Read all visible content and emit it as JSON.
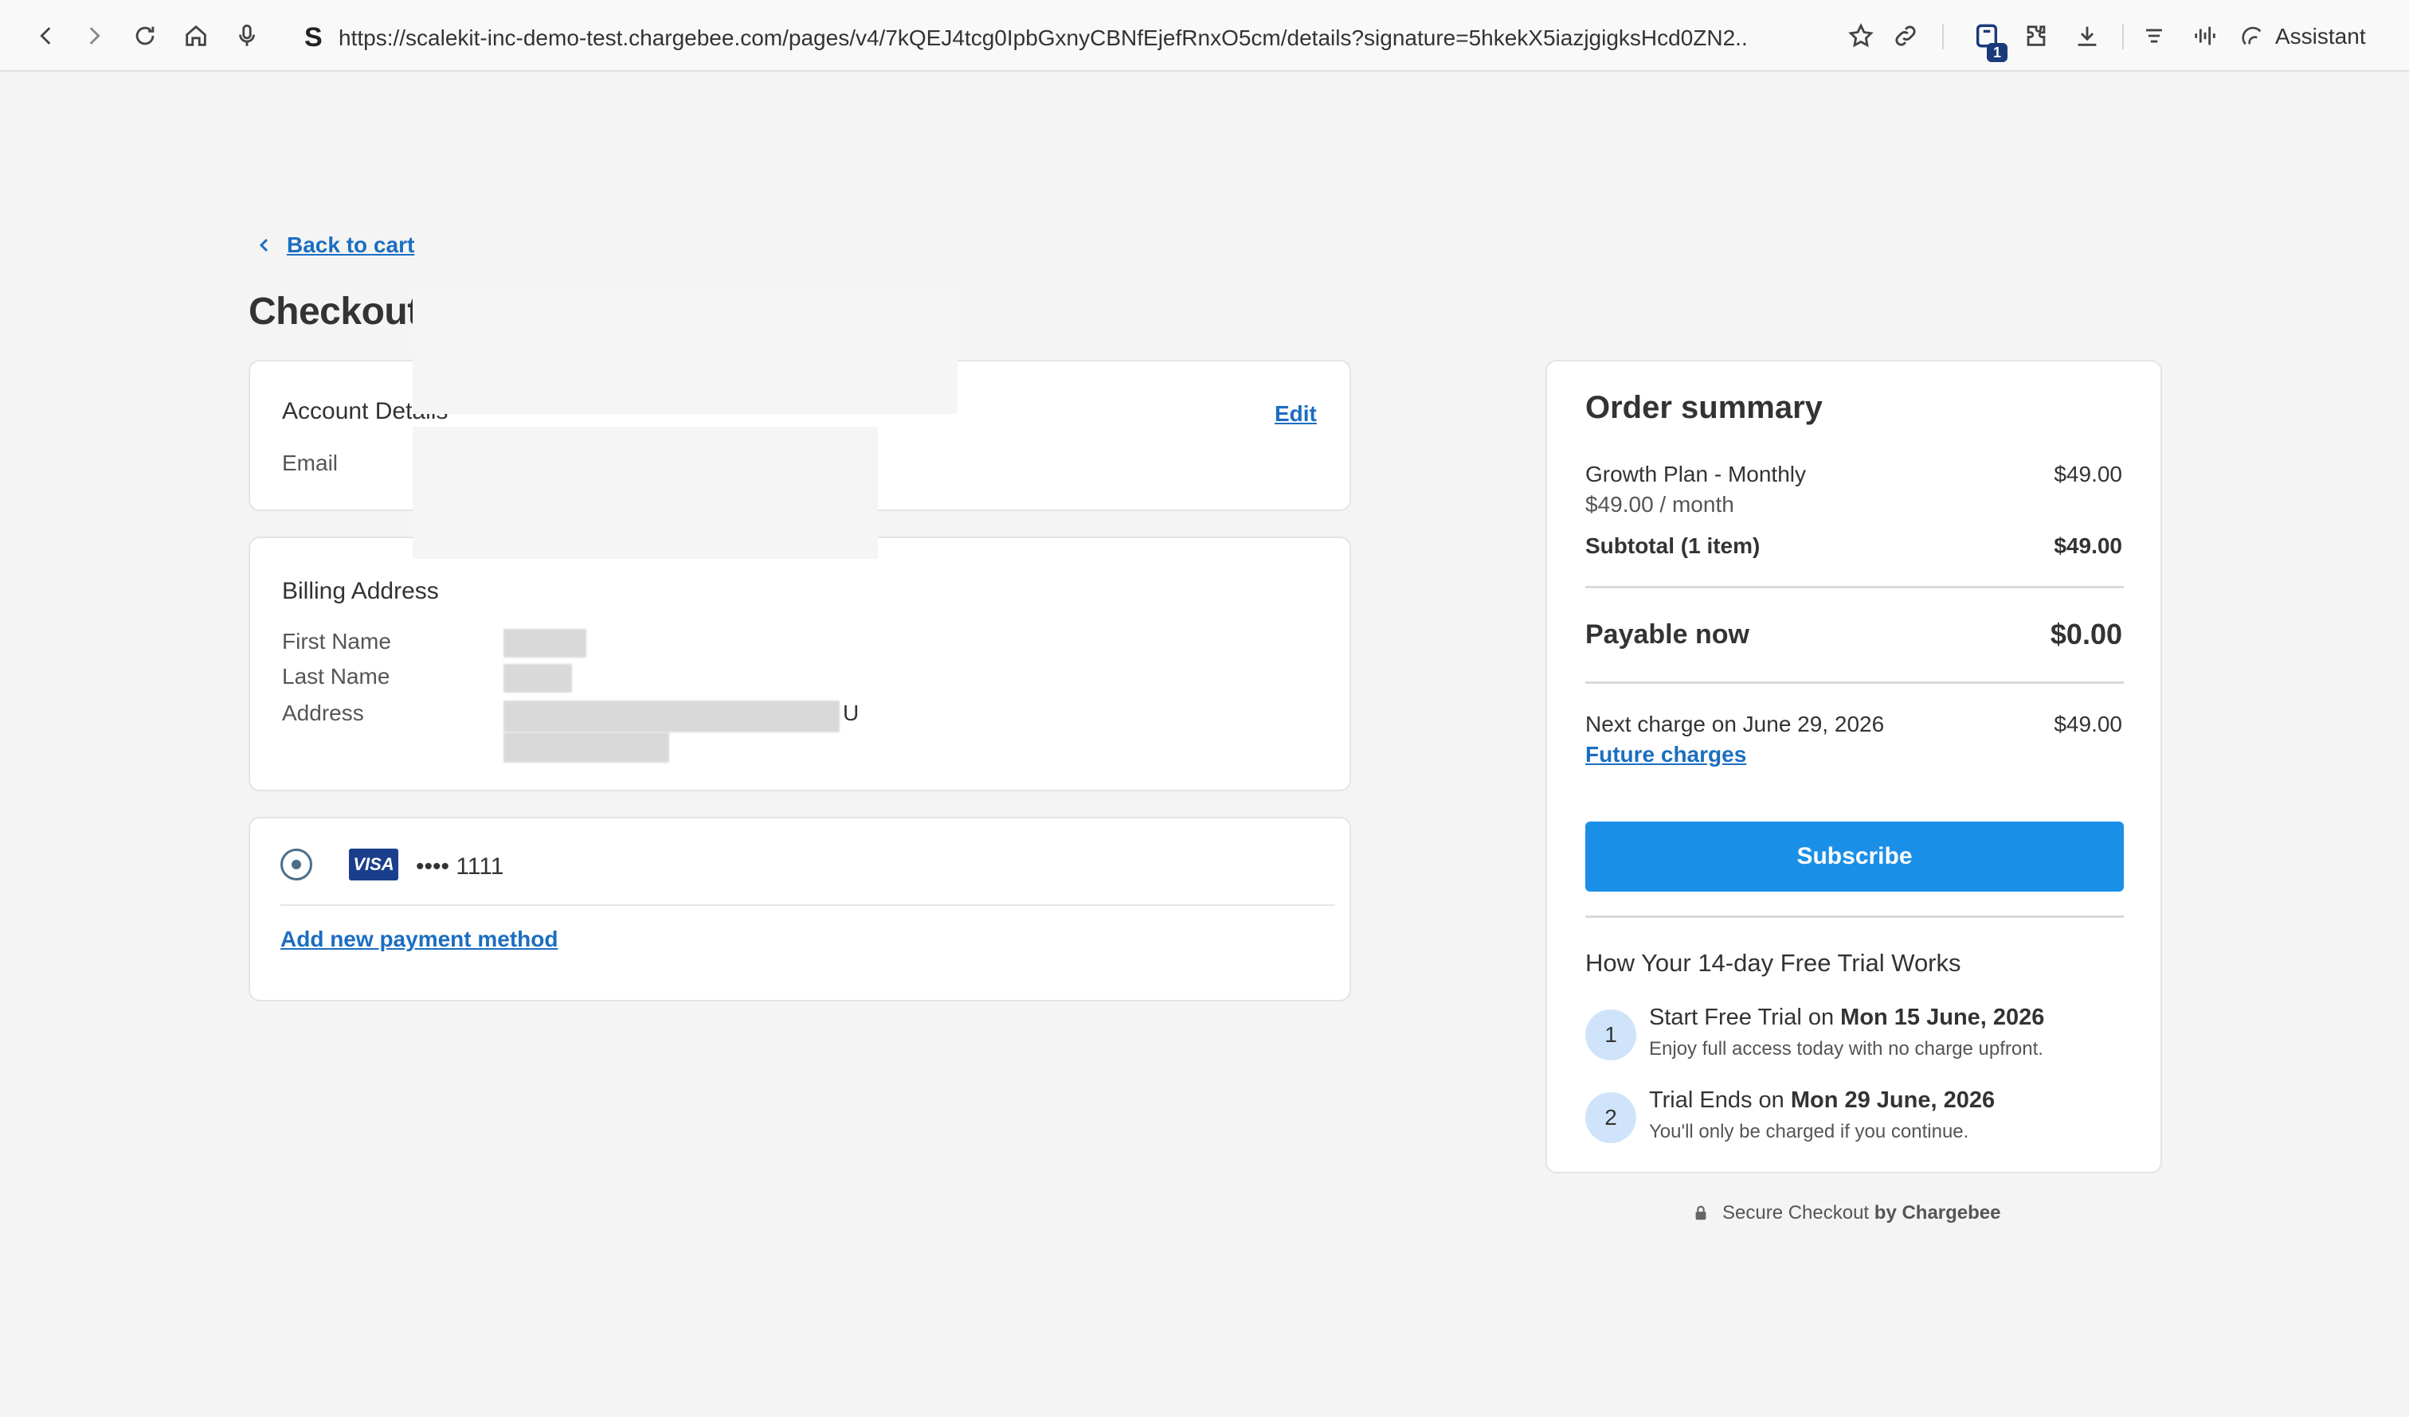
{
  "browser": {
    "url": "https://scalekit-inc-demo-test.chargebee.com/pages/v4/7kQEJ4tcg0IpbGxnyCBNfEjefRnxO5cm/details?signature=5hkekX5iazjgigksHcd0ZN2...",
    "favicon_letter": "S",
    "extension_badge": "1",
    "assistant_label": "Assistant"
  },
  "page": {
    "back_link": "Back to cart",
    "title": "Checkout"
  },
  "account": {
    "title": "Account Details",
    "edit_label": "Edit",
    "email_label": "Email"
  },
  "billing": {
    "title": "Billing Address",
    "first_name_label": "First Name",
    "last_name_label": "Last Name",
    "address_label": "Address",
    "address_fragment": "U"
  },
  "payment": {
    "card_brand": "VISA",
    "card_number": "•••• 1111",
    "add_new": "Add new payment method"
  },
  "summary": {
    "title": "Order summary",
    "plan_name": "Growth Plan - Monthly",
    "plan_price": "$49.00",
    "plan_rate": "$49.00 / month",
    "subtotal_label": "Subtotal (1 item)",
    "subtotal_value": "$49.00",
    "payable_label": "Payable now",
    "payable_value": "$0.00",
    "next_charge_label": "Next charge on June 29, 2026",
    "next_charge_value": "$49.00",
    "future_charges": "Future charges",
    "subscribe": "Subscribe",
    "trial_title": "How Your 14-day Free Trial Works",
    "steps": [
      {
        "num": "1",
        "prefix": "Start Free Trial on ",
        "date": "Mon 15 June, 2026",
        "sub": "Enjoy full access today with no charge upfront."
      },
      {
        "num": "2",
        "prefix": "Trial Ends on ",
        "date": "Mon 29 June, 2026",
        "sub": "You'll only be charged if you continue."
      }
    ]
  },
  "footer": {
    "secure_prefix": "Secure Checkout ",
    "secure_brand": "by Chargebee"
  }
}
